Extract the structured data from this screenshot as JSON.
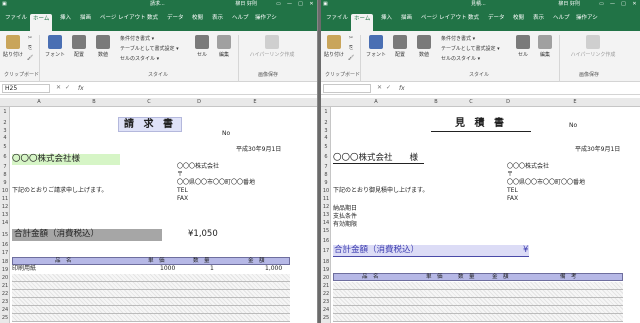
{
  "left": {
    "title_bar": {
      "title": "請求...",
      "user": "柳日 好則",
      "controls": [
        "▭",
        "—",
        "□",
        "✕"
      ]
    },
    "tabs": [
      "ファイル",
      "ホーム",
      "挿入",
      "描画",
      "ページ レイアウト",
      "数式",
      "データ",
      "校閲",
      "表示",
      "ヘルプ",
      "操作アシ"
    ],
    "ribbon": {
      "paste": "貼り付け",
      "font": "フォント",
      "align": "配置",
      "number": "数値",
      "cond_format": "条件付き書式 ▾",
      "table_format": "テーブルとして書式設定 ▾",
      "cell_style": "セルのスタイル ▾",
      "cells": "セル",
      "edit": "編集",
      "intelligence": "ハイパーリンク作成",
      "group_clipboard": "クリップボード",
      "group_style": "スタイル",
      "group_image": "画像保存"
    },
    "name_box": "H25",
    "fx": "fx",
    "columns": [
      "A",
      "B",
      "C",
      "D",
      "E"
    ],
    "rows": [
      "1",
      "2",
      "3",
      "4",
      "5",
      "6",
      "7",
      "8",
      "9",
      "10",
      "11",
      "12",
      "13",
      "14",
      "15",
      "16",
      "17",
      "18",
      "19",
      "20",
      "21",
      "22",
      "23",
      "24",
      "25"
    ],
    "doc": {
      "title": "請 求 書",
      "no": "No",
      "date": "平成30年9月1日",
      "company": "〇〇〇株式会社様",
      "sender": "〇〇〇株式会社",
      "postal": "〒",
      "address": "〇〇県〇〇市〇〇町〇〇番地",
      "msg": "下記のとおりご請求申し上げます。",
      "tel": "TEL",
      "fax": "FAX",
      "total_label": "合計金額（消費税込）",
      "total_value": "¥1,050",
      "h_item": "品　名",
      "h_price": "単　価",
      "h_qty": "数　量",
      "h_amount": "金　額",
      "r_item": "印刷用紙",
      "r_price": "1000",
      "r_qty": "1",
      "r_amount": "1,000"
    }
  },
  "right": {
    "title_bar": {
      "title": "見積...",
      "user": "柳日 好則",
      "controls": [
        "▭",
        "—",
        "□",
        "✕"
      ]
    },
    "tabs": [
      "ファイル",
      "ホーム",
      "挿入",
      "描画",
      "ページ レイアウト",
      "数式",
      "データ",
      "校閲",
      "表示",
      "ヘルプ",
      "操作アシ"
    ],
    "ribbon": {
      "paste": "貼り付け",
      "font": "フォント",
      "align": "配置",
      "number": "数値",
      "cond_format": "条件付き書式 ▾",
      "table_format": "テーブルとして書式設定 ▾",
      "cell_style": "セルのスタイル ▾",
      "cells": "セル",
      "edit": "編集",
      "intelligence": "ハイパーリンク作成",
      "group_clipboard": "クリップボード",
      "group_style": "スタイル",
      "group_image": "画像保存"
    },
    "name_box": "",
    "fx": "fx",
    "columns": [
      "A",
      "B",
      "C",
      "D",
      "E"
    ],
    "rows": [
      "1",
      "2",
      "3",
      "4",
      "5",
      "6",
      "7",
      "8",
      "9",
      "10",
      "11",
      "12",
      "13",
      "14",
      "15",
      "16",
      "17",
      "18",
      "19",
      "20",
      "21",
      "22",
      "23",
      "24",
      "25"
    ],
    "doc": {
      "title": "見 積 書",
      "no": "No",
      "date": "平成30年9月1日",
      "company": "〇〇〇株式会社　　様",
      "sender": "〇〇〇株式会社",
      "postal": "〒",
      "address": "〇〇県〇〇市〇〇町〇〇番地",
      "msg": "下記のとおり御見積申し上げます。",
      "tel": "TEL",
      "fax": "FAX",
      "delivery": "納品期日",
      "payment": "支払条件",
      "valid": "有効期限",
      "total_label": "合計金額（消費税込）",
      "total_value": "¥",
      "h_item": "品　名",
      "h_price": "単　価",
      "h_qty": "数　量",
      "h_amount": "金　額",
      "h_note": "備　考"
    }
  }
}
